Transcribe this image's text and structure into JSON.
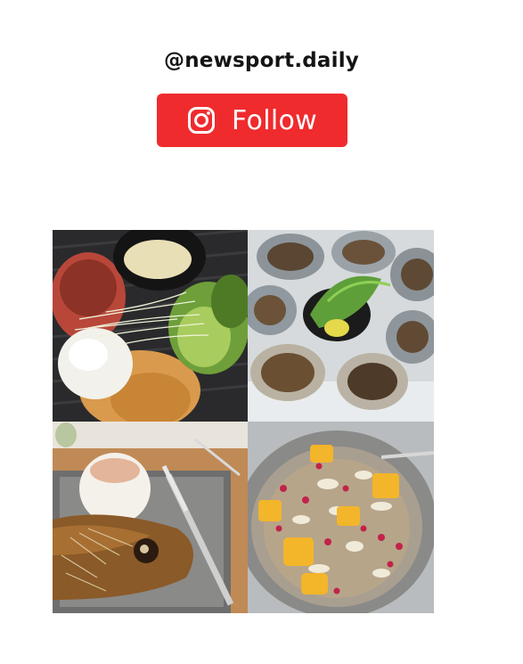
{
  "profile": {
    "handle": "@newsport.daily"
  },
  "follow_button": {
    "label": "Follow",
    "icon": "instagram-icon",
    "color": "#ef2b2e"
  },
  "gallery": {
    "photos": [
      {
        "subject": "poached-egg-avocado-toast"
      },
      {
        "subject": "grilled-oysters"
      },
      {
        "subject": "whole-fried-fish-with-rice"
      },
      {
        "subject": "mango-granola-bowl"
      }
    ]
  }
}
